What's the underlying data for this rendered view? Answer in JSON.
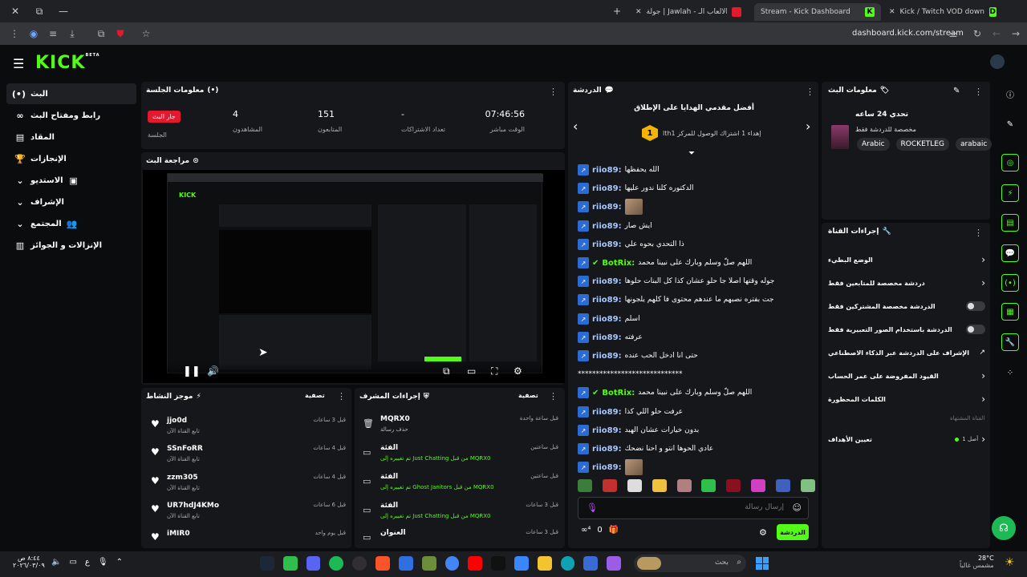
{
  "browser": {
    "tabs": [
      {
        "label": "Kick / Twitch VOD downloader",
        "fav": "D",
        "color": "#53fc18"
      },
      {
        "label": "Stream - Kick Dashboard",
        "fav": "K",
        "color": "#53fc18"
      },
      {
        "label": "جولة | Jawlah - منصة الألعاب الـ...",
        "fav": "",
        "color": "#e3192e"
      }
    ],
    "url": "dashboard.kick.com/stream"
  },
  "app": {
    "logo": "KICK",
    "beta": "BETA"
  },
  "sidebar": {
    "items": [
      {
        "label": "البث",
        "icon": "(•)"
      },
      {
        "label": "رابط ومفتاح البث",
        "icon": "∞"
      },
      {
        "label": "المقاد",
        "icon": "▤"
      },
      {
        "label": "الإنجازات",
        "icon": "🏆"
      },
      {
        "label": "الاستديو",
        "icon": "▣"
      },
      {
        "label": "الإشراف",
        "icon": "⛨"
      },
      {
        "label": "المجتمع",
        "icon": "👥"
      },
      {
        "label": "الإنزالات و الجوائز",
        "icon": "▥"
      }
    ]
  },
  "session": {
    "title": "معلومات الجلسة",
    "live_badge": "جار البث",
    "session_label": "الجلسة",
    "stats": [
      {
        "value": "07:46:56",
        "label": "الوقت مباشر"
      },
      {
        "value": "-",
        "label": "تعداد الاشتراكات"
      },
      {
        "value": "151",
        "label": "المتابعون"
      },
      {
        "value": "4",
        "label": "المشاهدون"
      }
    ]
  },
  "preview": {
    "title": "مراجعة البث"
  },
  "activity": {
    "title": "موجز النشاط",
    "filter": "تصفية",
    "rows": [
      {
        "name": "jjo0d",
        "sub": "تابع القناة الآن",
        "time": "قبل 3 ساعات"
      },
      {
        "name": "SSnFoRR",
        "sub": "تابع القناة الآن",
        "time": "قبل 4 ساعات"
      },
      {
        "name": "zzm305",
        "sub": "تابع القناة الآن",
        "time": "قبل 4 ساعات"
      },
      {
        "name": "UR7hdJ4KMo",
        "sub": "تابع القناة الآن",
        "time": "قبل 6 ساعات"
      },
      {
        "name": "iMIR0",
        "sub": "تابع القناة الآن",
        "time": "قبل يوم واحد"
      }
    ]
  },
  "mod": {
    "title": "إجراءات المشرف",
    "filter": "تصفية",
    "rows": [
      {
        "icon": "🗑",
        "name": "MQRX0",
        "sub": "حذف رسالة",
        "time": "قبل ساعة واحدة"
      },
      {
        "icon": "▭",
        "name": "الفئة",
        "sub": "MQRX0 من قبل Just Chatting تم تغييره إلى",
        "time": "قبل ساعتين"
      },
      {
        "icon": "▭",
        "name": "الفئة",
        "sub": "MQRX0 من قبل Ghost Janitors تم تغييره إلى",
        "time": "قبل ساعتين"
      },
      {
        "icon": "▭",
        "name": "الفئة",
        "sub": "MQRX0 من قبل Just Chatting تم تغييره إلى",
        "time": "قبل 3 ساعات"
      },
      {
        "icon": "▭",
        "name": "العنوان",
        "sub": "",
        "time": "قبل 3 ساعات"
      }
    ]
  },
  "chat": {
    "title": "الدردشة",
    "leaderboard_title": "أفضل مقدمي الهدايا على الإطلاق",
    "leaderboard_entry": "lthإهداء 1 اشتراك الوصول للمركز 1",
    "leaderboard_rank": "1",
    "messages": [
      {
        "user": "riio89:",
        "text": "الله يحفظها",
        "type": "text"
      },
      {
        "user": "riio89:",
        "text": "الدكتوره كلنا ندور عليها",
        "type": "text"
      },
      {
        "user": "riio89:",
        "text": "",
        "type": "img"
      },
      {
        "user": "riio89:",
        "text": "ايش صار",
        "type": "text"
      },
      {
        "user": "riio89:",
        "text": "ذا التحدي بحوه علي",
        "type": "text"
      },
      {
        "user": "BotRix:",
        "text": "اللهم صلّ وسلم وبارك على نبينا محمد",
        "type": "bot"
      },
      {
        "user": "riio89:",
        "text": "جوله وقتها اصلا جا حلو عشان كذا كل البنات حلوها",
        "type": "text"
      },
      {
        "user": "riio89:",
        "text": "جت بفتره نصبهم ما عندهم محتوى فا كلهم يلجونها",
        "type": "text"
      },
      {
        "user": "riio89:",
        "text": "اسلم",
        "type": "text"
      },
      {
        "user": "riio89:",
        "text": "عرفته",
        "type": "text"
      },
      {
        "user": "riio89:",
        "text": "حتى انا ادخل الحب عنده",
        "type": "text"
      },
      {
        "user": "",
        "text": "*****************************",
        "type": "raw"
      },
      {
        "user": "BotRix:",
        "text": "اللهم صلّ وسلم وبارك على نبينا محمد",
        "type": "bot"
      },
      {
        "user": "riio89:",
        "text": "عرفت حلو اللي كذا",
        "type": "text"
      },
      {
        "user": "riio89:",
        "text": "بدون خيارات عشان الهبد",
        "type": "text"
      },
      {
        "user": "riio89:",
        "text": "عادي الحوها انتو و احنا نضحك",
        "type": "text"
      },
      {
        "user": "riio89:",
        "text": "",
        "type": "img"
      }
    ],
    "input_placeholder": "إرسال رسالة",
    "send_label": "الدردشة",
    "count": "0"
  },
  "stream_info": {
    "title": "معلومات البث",
    "stream_title": "تحدي 24 ساعه",
    "category": "مخصصة للدردشة فقط",
    "tags": [
      "arabaic",
      "ROCKETLEG",
      "Arabic"
    ]
  },
  "channel_actions": {
    "title": "إجراءات القناة",
    "rows": [
      {
        "label": "الوضع البطيء",
        "kind": "chev"
      },
      {
        "label": "دردشة مخصصة للمتابعين فقط",
        "kind": "chev"
      },
      {
        "label": "الدردشة مخصصة المشتركين فقط",
        "kind": "toggle"
      },
      {
        "label": "الدردشة باستخدام الصور التعبيرية فقط",
        "kind": "toggle"
      },
      {
        "label": "الإشراف على الدردشة عبر الذكاء الاصطناعي",
        "kind": "ext"
      },
      {
        "label": "القيود المفروضة على عمر الحساب",
        "kind": "chev"
      },
      {
        "label": "الكلمات المحظورة",
        "kind": "chev"
      }
    ],
    "section_label": "القناة المشتهاة",
    "goals_label": "تعيين الأهداف",
    "goals_value": "أصل 1"
  },
  "taskbar": {
    "search": "بحث",
    "temp": "28°C",
    "weather": "مشمس غالباً",
    "time": "٨:٤٤ ص",
    "date": "٢٠٢٦/٠٣/٠٩",
    "lang": "ع"
  }
}
